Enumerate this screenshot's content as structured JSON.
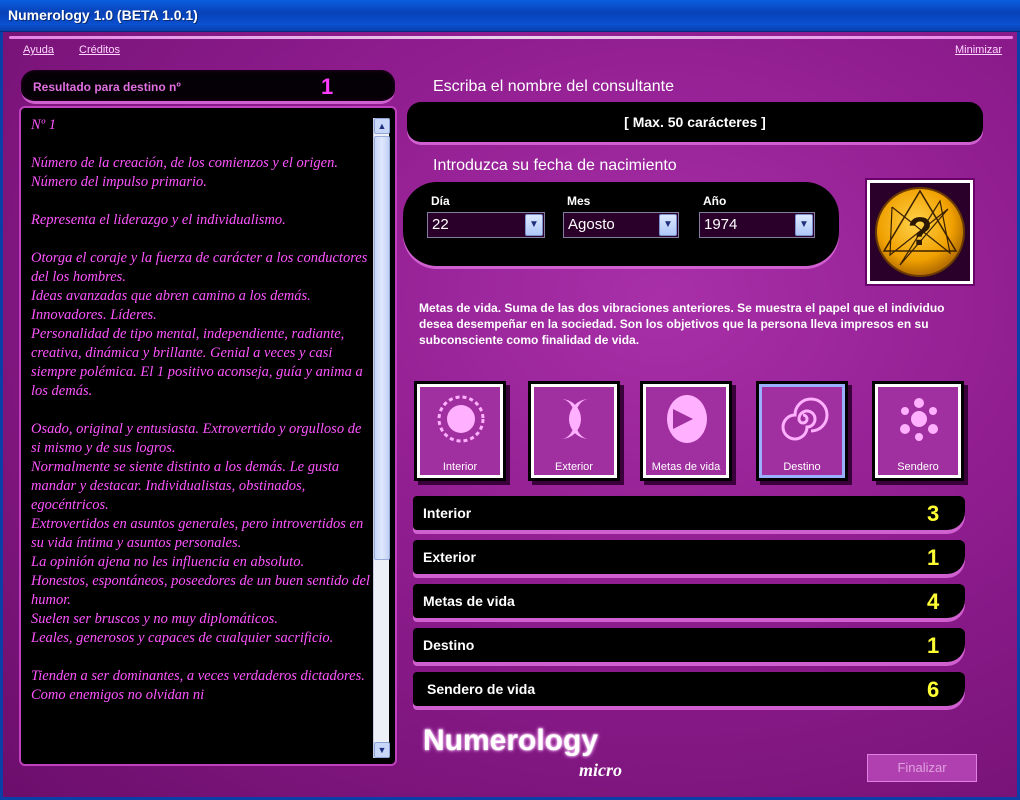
{
  "window": {
    "title": "Numerology 1.0 (BETA 1.0.1)"
  },
  "menu": {
    "help": "Ayuda",
    "credits": "Créditos",
    "minimize": "Minimizar"
  },
  "result": {
    "header_label": "Resultado para destino nº",
    "number": "1",
    "text": "Nº 1\n\nNúmero de la creación, de los comienzos y el origen.\nNúmero del impulso primario.\n\nRepresenta el liderazgo y el individualismo.\n\nOtorga el coraje y la fuerza de carácter a los conductores del los hombres.\nIdeas avanzadas que abren camino a los demás.\nInnovadores. Líderes.\nPersonalidad de tipo mental, independiente, radiante, creativa, dinámica y brillante. Genial a veces y casi siempre polémica. El 1 positivo aconseja, guía y anima a los demás.\n\nOsado, original y entusiasta. Extrovertido y orgulloso de si mismo y de sus logros.\nNormalmente se siente distinto a los demás. Le gusta mandar y destacar. Individualistas, obstinados, egocéntricos.\nExtrovertidos en asuntos generales, pero introvertidos en  su vida íntima y asuntos personales.\nLa opinión ajena no les influencia en absoluto.\nHonestos, espontáneos, poseedores de un buen sentido del humor.\nSuelen ser bruscos y no muy diplomáticos.\nLeales, generosos y capaces de cualquier sacrificio.\n\nTienden a ser dominantes, a veces verdaderos dictadores. Como enemigos no olvidan ni"
  },
  "name": {
    "title": "Escriba el nombre del consultante",
    "placeholder": "[ Max. 50 carácteres ]"
  },
  "birth": {
    "title": "Introduzca su fecha de nacimiento",
    "day_label": "Día",
    "day_value": "22",
    "month_label": "Mes",
    "month_value": "Agosto",
    "year_label": "Año",
    "year_value": "1974"
  },
  "description": "Metas de vida. Suma de las dos vibraciones anteriores. Se muestra el papel que el individuo desea desempeñar en la sociedad. Son los objetivos que la persona lleva impresos en su subconsciente como finalidad de vida.",
  "cards": [
    {
      "label": "Interior",
      "icon": "sun-icon"
    },
    {
      "label": "Exterior",
      "icon": "crescents-icon"
    },
    {
      "label": "Metas de vida",
      "icon": "arrow-icon"
    },
    {
      "label": "Destino",
      "icon": "spiral-icon"
    },
    {
      "label": "Sendero",
      "icon": "circles-icon"
    }
  ],
  "results": [
    {
      "label": "Interior",
      "value": "3"
    },
    {
      "label": "Exterior",
      "value": "1"
    },
    {
      "label": "Metas de vida",
      "value": "4"
    },
    {
      "label": "Destino",
      "value": "1"
    },
    {
      "label": "Sendero de vida",
      "value": "6"
    }
  ],
  "brand": {
    "logo": "Numerology",
    "sub": "micro"
  },
  "finish_button": "Finalizar",
  "colors": {
    "background": "#8e1c8e",
    "accent": "#d060d0",
    "value": "#ffff33",
    "text": "#ff55ff"
  }
}
